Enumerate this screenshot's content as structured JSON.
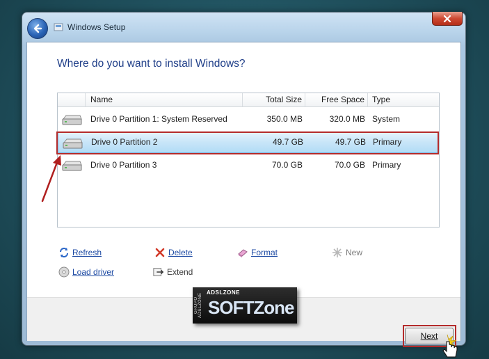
{
  "window": {
    "title": "Windows Setup"
  },
  "heading": "Where do you want to install Windows?",
  "table": {
    "columns": [
      "Name",
      "Total Size",
      "Free Space",
      "Type"
    ],
    "rows": [
      {
        "name": "Drive 0 Partition 1: System Reserved",
        "total": "350.0 MB",
        "free": "320.0 MB",
        "type": "System",
        "selected": false
      },
      {
        "name": "Drive 0 Partition 2",
        "total": "49.7 GB",
        "free": "49.7 GB",
        "type": "Primary",
        "selected": true
      },
      {
        "name": "Drive 0 Partition 3",
        "total": "70.0 GB",
        "free": "70.0 GB",
        "type": "Primary",
        "selected": false
      }
    ]
  },
  "actions": {
    "refresh": "Refresh",
    "delete": "Delete",
    "format": "Format",
    "new": "New",
    "load_driver": "Load driver",
    "extend": "Extend"
  },
  "watermark": {
    "top": "ADSLZONE",
    "main": "SOFTZone",
    "side": "GRUPO ADSLZONE"
  },
  "buttons": {
    "next": "Next"
  },
  "colors": {
    "heading": "#1f3e88",
    "link": "#1d4aa3",
    "highlight": "#b42b2b",
    "selection": "#c8e5f8"
  }
}
